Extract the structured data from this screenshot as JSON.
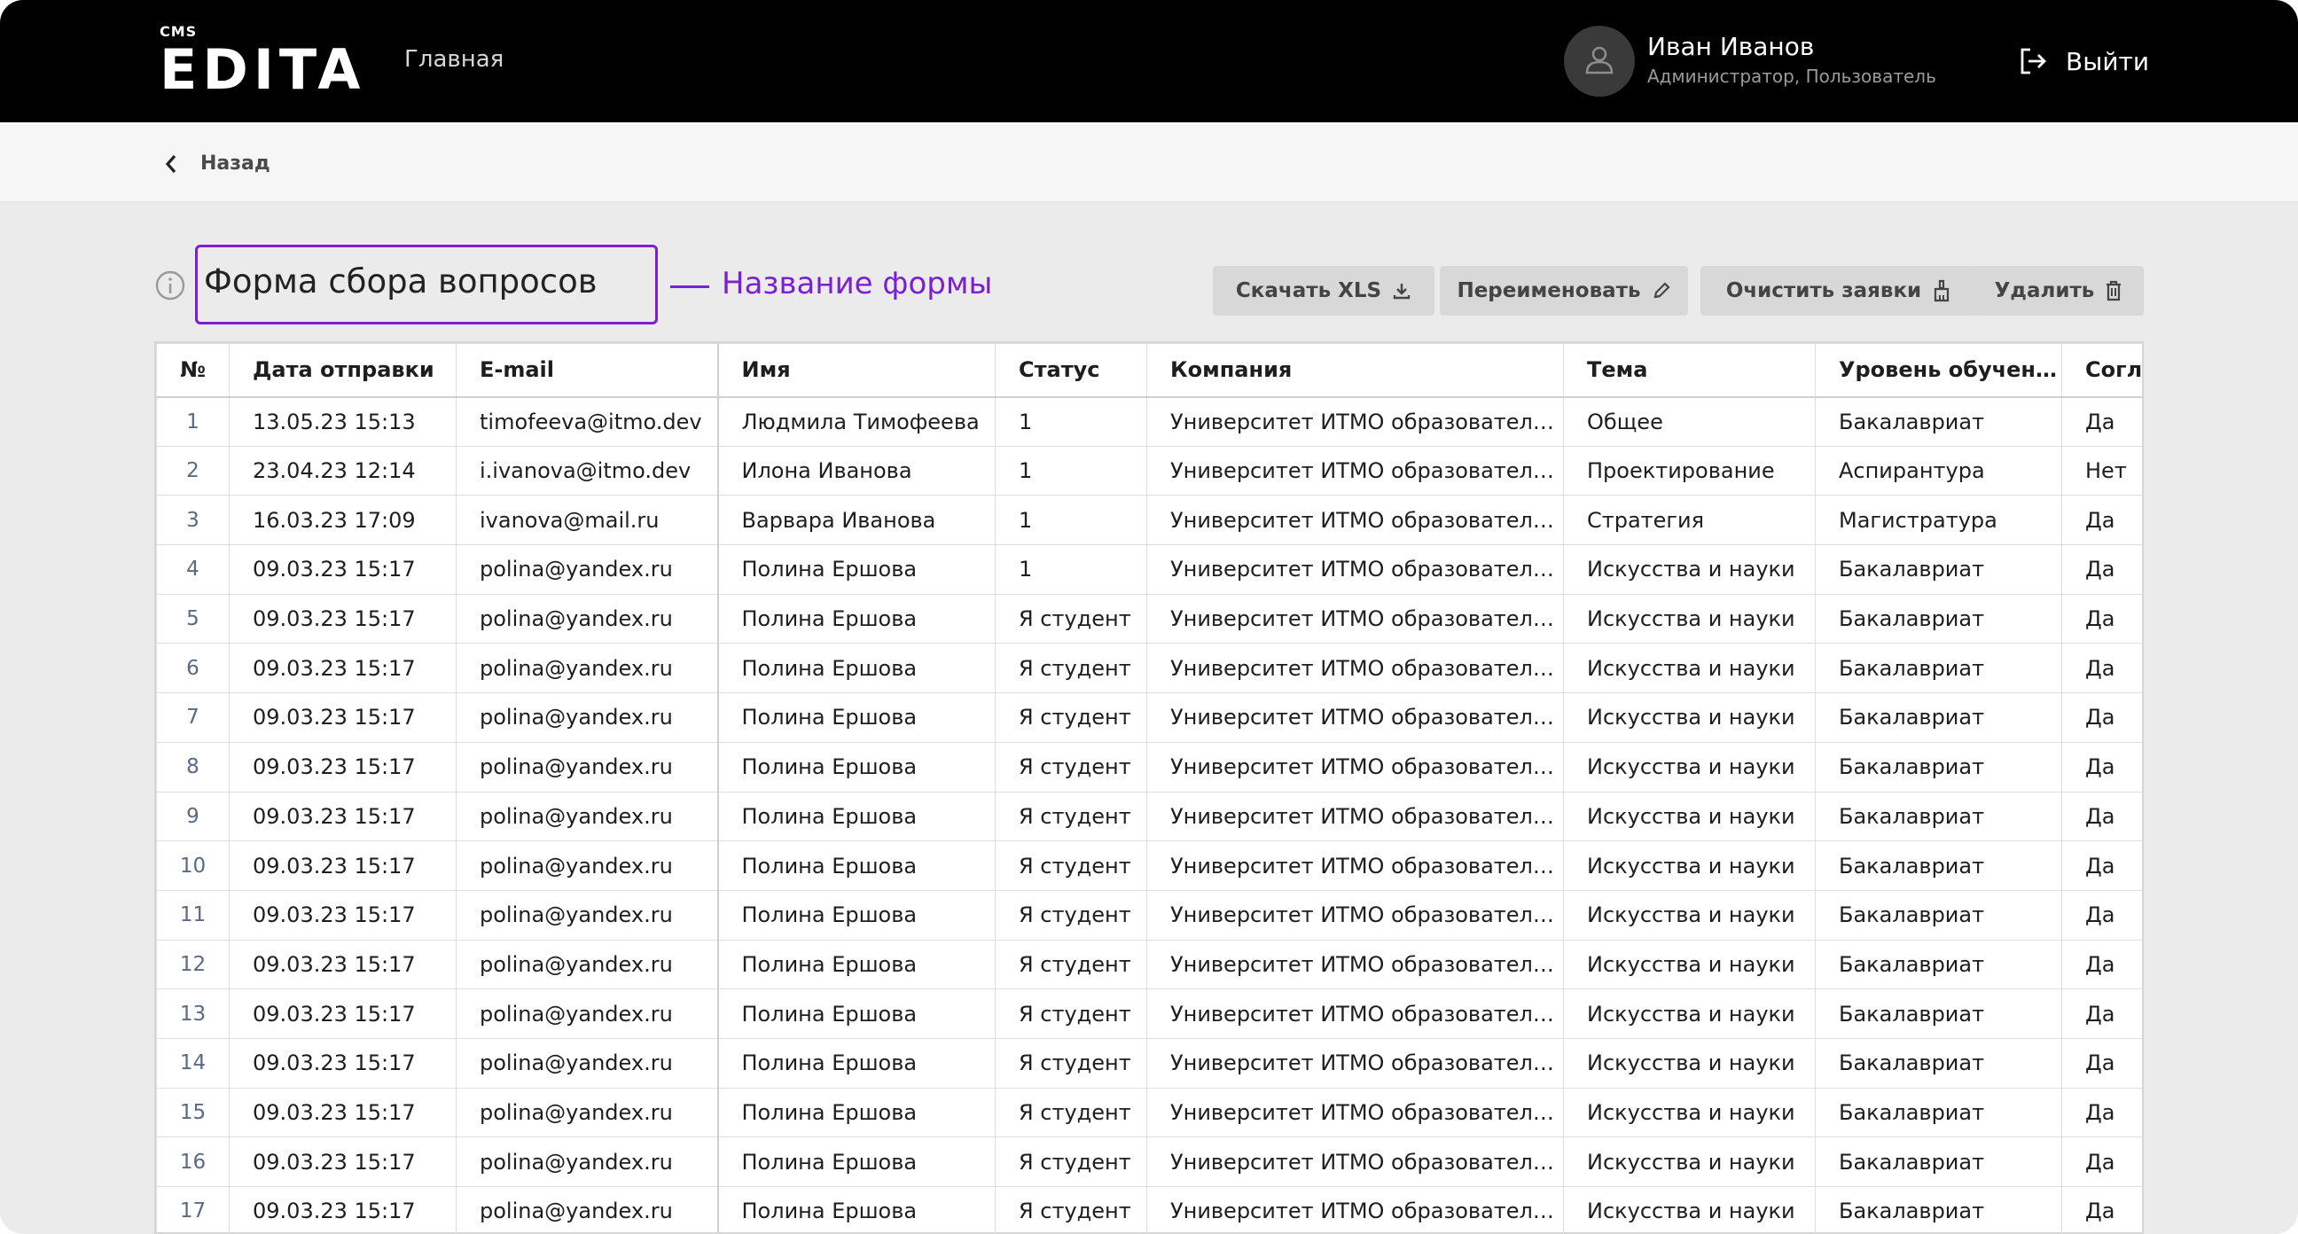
{
  "header": {
    "logo_small": "CMS",
    "logo_main": "EDITA",
    "nav_home": "Главная",
    "user_name": "Иван Иванов",
    "user_role": "Администратор, Пользователь",
    "logout_label": "Выйти"
  },
  "breadcrumb": {
    "back_label": "Назад"
  },
  "form": {
    "title": "Форма сбора вопросов",
    "annotation": "Название формы",
    "accent_color": "#7b1fd1"
  },
  "toolbar": {
    "download_label": "Скачать XLS",
    "rename_label": "Переименовать",
    "clear_label": "Очистить заявки",
    "delete_label": "Удалить"
  },
  "table": {
    "columns": [
      "№",
      "Дата отправки",
      "E-mail",
      "Имя",
      "Статус",
      "Компания",
      "Тема",
      "Уровень обучения",
      "Согла"
    ],
    "rows": [
      [
        "1",
        "13.05.23 15:13",
        "timofeeva@itmo.dev",
        "Людмила Тимофеева",
        "1",
        "Университет ИТМО образовательное учреждение",
        "Общее",
        "Бакалавриат",
        "Да"
      ],
      [
        "2",
        "23.04.23 12:14",
        "i.ivanova@itmo.dev",
        "Илона Иванова",
        "1",
        "Университет ИТМО образовательное учреждение",
        "Проектирование",
        "Аспирантура",
        "Нет"
      ],
      [
        "3",
        "16.03.23 17:09",
        "ivanova@mail.ru",
        "Варвара Иванова",
        "1",
        "Университет ИТМО образовательное учреждение",
        "Стратегия",
        "Магистратура",
        "Да"
      ],
      [
        "4",
        "09.03.23 15:17",
        "polina@yandex.ru",
        "Полина Ершова",
        "1",
        "Университет ИТМО образовательное учреждение",
        "Искусства и науки",
        "Бакалавриат",
        "Да"
      ],
      [
        "5",
        "09.03.23 15:17",
        "polina@yandex.ru",
        "Полина Ершова",
        "Я студент",
        "Университет ИТМО образовательное учреждение",
        "Искусства и науки",
        "Бакалавриат",
        "Да"
      ],
      [
        "6",
        "09.03.23 15:17",
        "polina@yandex.ru",
        "Полина Ершова",
        "Я студент",
        "Университет ИТМО образовательное учреждение",
        "Искусства и науки",
        "Бакалавриат",
        "Да"
      ],
      [
        "7",
        "09.03.23 15:17",
        "polina@yandex.ru",
        "Полина Ершова",
        "Я студент",
        "Университет ИТМО образовательное учреждение",
        "Искусства и науки",
        "Бакалавриат",
        "Да"
      ],
      [
        "8",
        "09.03.23 15:17",
        "polina@yandex.ru",
        "Полина Ершова",
        "Я студент",
        "Университет ИТМО образовательное учреждение",
        "Искусства и науки",
        "Бакалавриат",
        "Да"
      ],
      [
        "9",
        "09.03.23 15:17",
        "polina@yandex.ru",
        "Полина Ершова",
        "Я студент",
        "Университет ИТМО образовательное учреждение",
        "Искусства и науки",
        "Бакалавриат",
        "Да"
      ],
      [
        "10",
        "09.03.23 15:17",
        "polina@yandex.ru",
        "Полина Ершова",
        "Я студент",
        "Университет ИТМО образовательное учреждение",
        "Искусства и науки",
        "Бакалавриат",
        "Да"
      ],
      [
        "11",
        "09.03.23 15:17",
        "polina@yandex.ru",
        "Полина Ершова",
        "Я студент",
        "Университет ИТМО образовательное учреждение",
        "Искусства и науки",
        "Бакалавриат",
        "Да"
      ],
      [
        "12",
        "09.03.23 15:17",
        "polina@yandex.ru",
        "Полина Ершова",
        "Я студент",
        "Университет ИТМО образовательное учреждение",
        "Искусства и науки",
        "Бакалавриат",
        "Да"
      ],
      [
        "13",
        "09.03.23 15:17",
        "polina@yandex.ru",
        "Полина Ершова",
        "Я студент",
        "Университет ИТМО образовательное учреждение",
        "Искусства и науки",
        "Бакалавриат",
        "Да"
      ],
      [
        "14",
        "09.03.23 15:17",
        "polina@yandex.ru",
        "Полина Ершова",
        "Я студент",
        "Университет ИТМО образовательное учреждение",
        "Искусства и науки",
        "Бакалавриат",
        "Да"
      ],
      [
        "15",
        "09.03.23 15:17",
        "polina@yandex.ru",
        "Полина Ершова",
        "Я студент",
        "Университет ИТМО образовательное учреждение",
        "Искусства и науки",
        "Бакалавриат",
        "Да"
      ],
      [
        "16",
        "09.03.23 15:17",
        "polina@yandex.ru",
        "Полина Ершова",
        "Я студент",
        "Университет ИТМО образовательное учреждение",
        "Искусства и науки",
        "Бакалавриат",
        "Да"
      ],
      [
        "17",
        "09.03.23 15:17",
        "polina@yandex.ru",
        "Полина Ершова",
        "Я студент",
        "Университет ИТМО образовательное учреждение",
        "Искусства и науки",
        "Бакалавриат",
        "Да"
      ]
    ]
  }
}
